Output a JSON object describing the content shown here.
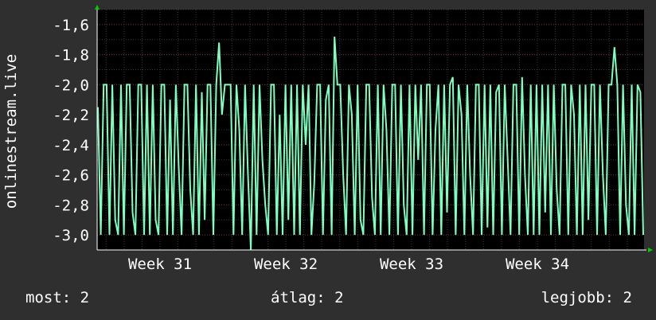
{
  "chart_data": {
    "type": "line",
    "title": "",
    "xlabel": "",
    "ylabel": "onlinestream.live",
    "ylim": [
      -3.1,
      -1.5
    ],
    "y_ticks": [
      -1.6,
      -1.8,
      -2.0,
      -2.2,
      -2.4,
      -2.6,
      -2.8,
      -3.0
    ],
    "y_tick_labels": [
      "-1,6",
      "-1,8",
      "-2,0",
      "-2,2",
      "-2,4",
      "-2,6",
      "-2,8",
      "-3,0"
    ],
    "x_ticks": [
      "Week 31",
      "Week 32",
      "Week 33",
      "Week 34"
    ],
    "grid": true,
    "series": [
      {
        "color": "#7fffbf",
        "values": [
          -2.15,
          -3.0,
          -2.0,
          -2.0,
          -3.0,
          -2.0,
          -2.9,
          -3.0,
          -2.0,
          -3.0,
          -2.0,
          -2.0,
          -2.85,
          -3.0,
          -2.0,
          -2.0,
          -3.0,
          -2.0,
          -3.0,
          -2.0,
          -2.9,
          -3.0,
          -2.0,
          -2.0,
          -3.0,
          -2.1,
          -3.0,
          -2.0,
          -2.55,
          -3.0,
          -2.0,
          -2.0,
          -2.7,
          -3.0,
          -2.0,
          -3.0,
          -2.05,
          -2.9,
          -2.0,
          -2.0,
          -3.0,
          -2.0,
          -1.72,
          -2.2,
          -2.0,
          -2.0,
          -2.0,
          -3.0,
          -2.0,
          -2.3,
          -3.0,
          -2.0,
          -2.6,
          -3.1,
          -2.0,
          -3.0,
          -2.0,
          -2.5,
          -2.8,
          -3.0,
          -2.0,
          -2.0,
          -3.0,
          -2.2,
          -3.0,
          -2.0,
          -2.9,
          -2.0,
          -3.0,
          -2.0,
          -3.0,
          -2.0,
          -2.4,
          -2.0,
          -3.0,
          -2.65,
          -2.0,
          -2.0,
          -3.0,
          -2.1,
          -2.0,
          -3.0,
          -1.68,
          -2.0,
          -2.0,
          -2.6,
          -3.0,
          -2.0,
          -2.2,
          -3.0,
          -2.0,
          -2.9,
          -3.0,
          -2.0,
          -2.0,
          -2.75,
          -3.0,
          -2.0,
          -3.0,
          -2.0,
          -2.3,
          -3.0,
          -2.0,
          -2.0,
          -3.0,
          -2.0,
          -2.8,
          -3.0,
          -2.0,
          -3.0,
          -2.0,
          -2.5,
          -2.0,
          -3.0,
          -2.0,
          -2.0,
          -3.0,
          -2.3,
          -2.0,
          -3.0,
          -2.0,
          -2.85,
          -2.0,
          -1.95,
          -3.0,
          -2.0,
          -2.2,
          -3.0,
          -2.0,
          -2.6,
          -3.0,
          -2.0,
          -2.0,
          -3.0,
          -2.0,
          -2.95,
          -2.0,
          -3.0,
          -2.05,
          -2.0,
          -3.0,
          -2.0,
          -2.5,
          -3.0,
          -2.0,
          -2.0,
          -3.0,
          -1.95,
          -2.6,
          -3.0,
          -2.0,
          -3.0,
          -2.0,
          -3.0,
          -2.0,
          -2.85,
          -2.0,
          -3.0,
          -2.0,
          -2.7,
          -3.0,
          -2.0,
          -2.0,
          -3.0,
          -2.0,
          -2.2,
          -3.0,
          -2.0,
          -3.0,
          -2.0,
          -2.9,
          -2.0,
          -2.0,
          -3.0,
          -2.0,
          -2.6,
          -3.0,
          -2.0,
          -2.0,
          -1.75,
          -2.0,
          -3.0,
          -2.0,
          -2.8,
          -3.0,
          -2.0,
          -3.0,
          -2.0,
          -2.05,
          -3.0
        ]
      }
    ]
  },
  "stats": {
    "most": "most: 2",
    "atlag": "átlag: 2",
    "legjobb": "legjobb: 2"
  }
}
